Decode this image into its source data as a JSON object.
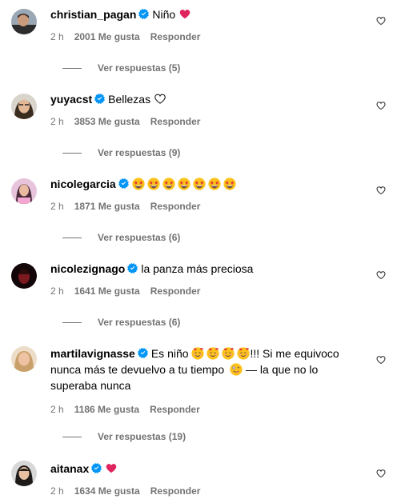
{
  "comments": [
    {
      "username": "christian_pagan",
      "text": "Niño",
      "time": "2 h",
      "likes": "2001 Me gusta",
      "reply": "Responder",
      "replies": "Ver respuestas (5)",
      "suffix_icon": "red-heart-emoji"
    },
    {
      "username": "yuyacst",
      "text": "Bellezas",
      "time": "2 h",
      "likes": "3853 Me gusta",
      "reply": "Responder",
      "replies": "Ver respuestas (9)",
      "suffix_icon": "white-heart-emoji"
    },
    {
      "username": "nicolegarcia",
      "text": "",
      "time": "2 h",
      "likes": "1871 Me gusta",
      "reply": "Responder",
      "replies": "Ver respuestas (6)",
      "emoji_count": 7,
      "emoji_icon": "star-struck-emoji"
    },
    {
      "username": "nicolezignago",
      "text": "la panza más preciosa",
      "time": "2 h",
      "likes": "1641 Me gusta",
      "reply": "Responder",
      "replies": "Ver respuestas (6)"
    },
    {
      "username": "martilavignasse",
      "text_a": "Es niño",
      "text_b": "!!! Si me equivoco",
      "text_c": "nunca más te devuelvo a tu tiempo",
      "text_d": "— la que no lo",
      "text_e": "superaba nunca",
      "time": "2 h",
      "likes": "1186 Me gusta",
      "reply": "Responder",
      "replies": "Ver respuestas (19)"
    },
    {
      "username": "aitanax",
      "text": "",
      "time": "2 h",
      "likes": "1634 Me gusta",
      "reply": "Responder",
      "suffix_icon": "red-heart-emoji"
    }
  ],
  "colors": {
    "verified": "#0095f6",
    "meta_text": "#737373",
    "red_heart": "#e0245e"
  }
}
